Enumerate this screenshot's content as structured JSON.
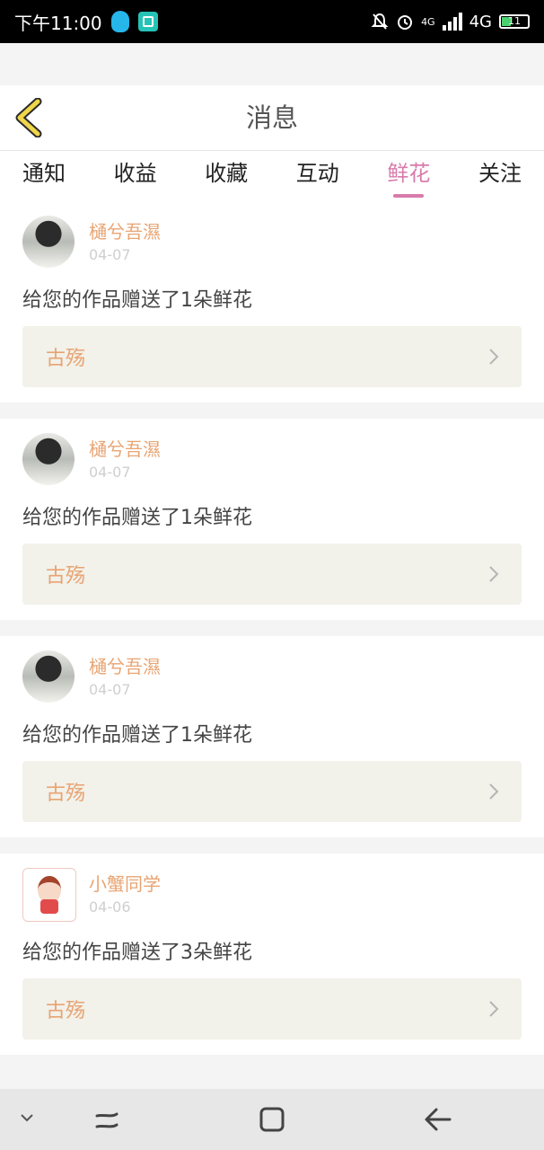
{
  "status_bar": {
    "time": "下午11:00",
    "network_small": "4G",
    "network": "4G",
    "battery": "11"
  },
  "header": {
    "title": "消息"
  },
  "tabs": [
    {
      "label": "通知",
      "active": false
    },
    {
      "label": "收益",
      "active": false
    },
    {
      "label": "收藏",
      "active": false
    },
    {
      "label": "互动",
      "active": false
    },
    {
      "label": "鲜花",
      "active": true
    },
    {
      "label": "关注",
      "active": false
    }
  ],
  "messages": [
    {
      "user": "樋兮吾濕",
      "date": "04-07",
      "text": "给您的作品赠送了1朵鲜花",
      "work": "古殇"
    },
    {
      "user": "樋兮吾濕",
      "date": "04-07",
      "text": "给您的作品赠送了1朵鲜花",
      "work": "古殇"
    },
    {
      "user": "樋兮吾濕",
      "date": "04-07",
      "text": "给您的作品赠送了1朵鲜花",
      "work": "古殇"
    },
    {
      "user": "小蟹同学",
      "date": "04-06",
      "text": "给您的作品赠送了3朵鲜花",
      "work": "古殇"
    }
  ],
  "colors": {
    "accent": "#d87cab",
    "username": "#e8a472",
    "back_icon": "#f0d64a"
  }
}
